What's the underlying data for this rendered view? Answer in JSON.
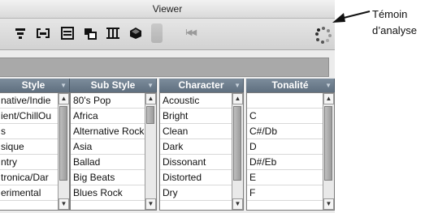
{
  "window": {
    "title": "Viewer"
  },
  "callout": {
    "line1": "Témoin",
    "line2": "d’analyse"
  },
  "toolbar": {
    "icons": [
      "sort-lines-icon",
      "bracket-lines-icon",
      "list-box-icon",
      "window-stack-icon",
      "columns-icon",
      "cubes-icon"
    ],
    "rewind_label": "I◀◀"
  },
  "columns": [
    {
      "header": "Style",
      "rows": [
        "native/Indie",
        "ient/ChillOu",
        "s",
        "sique",
        "ntry",
        "tronica/Dar",
        "erimental"
      ]
    },
    {
      "header": "Sub Style",
      "rows": [
        "80's Pop",
        "Africa",
        "Alternative Rock",
        "Asia",
        "Ballad",
        "Big Beats",
        "Blues Rock"
      ]
    },
    {
      "header": "Character",
      "rows": [
        "Acoustic",
        "Bright",
        "Clean",
        "Dark",
        "Dissonant",
        "Distorted",
        "Dry"
      ]
    },
    {
      "header": "Tonalité",
      "rows": [
        "",
        "C",
        "C#/Db",
        "D",
        "D#/Eb",
        "E",
        "F"
      ]
    }
  ],
  "scroll_glyphs": {
    "up": "▲",
    "down": "▼"
  },
  "colors": {
    "header_bg": "#6e7e8e",
    "search_bar": "#a9a9a9"
  }
}
